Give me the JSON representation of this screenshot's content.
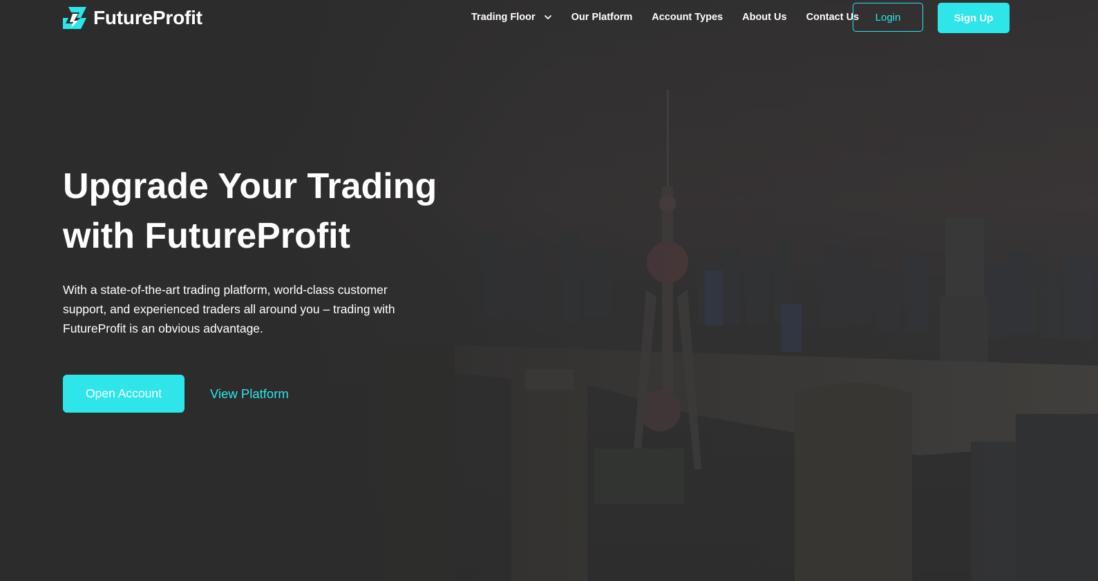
{
  "brand": {
    "name": "FutureProfit",
    "accent": "#2ee6ea",
    "logo_icon": "bolt-icon"
  },
  "nav": {
    "items": [
      {
        "label": "Trading Floor",
        "has_dropdown": true
      },
      {
        "label": "Our Platform"
      },
      {
        "label": "Account Types"
      },
      {
        "label": "About Us"
      },
      {
        "label": "Contact Us"
      }
    ],
    "login_label": "Login",
    "signup_label": "Sign Up"
  },
  "hero": {
    "title_line1": "Upgrade Your Trading",
    "title_line2": "with FutureProfit",
    "description": "With a state-of-the-art trading platform, world-class customer support, and experienced traders all around you – trading with FutureProfit is an obvious advantage.",
    "primary_cta": "Open Account",
    "secondary_cta": "View Platform"
  },
  "colors": {
    "background": "#2c2c2c",
    "accent": "#2ee6ea",
    "text": "#ffffff"
  }
}
